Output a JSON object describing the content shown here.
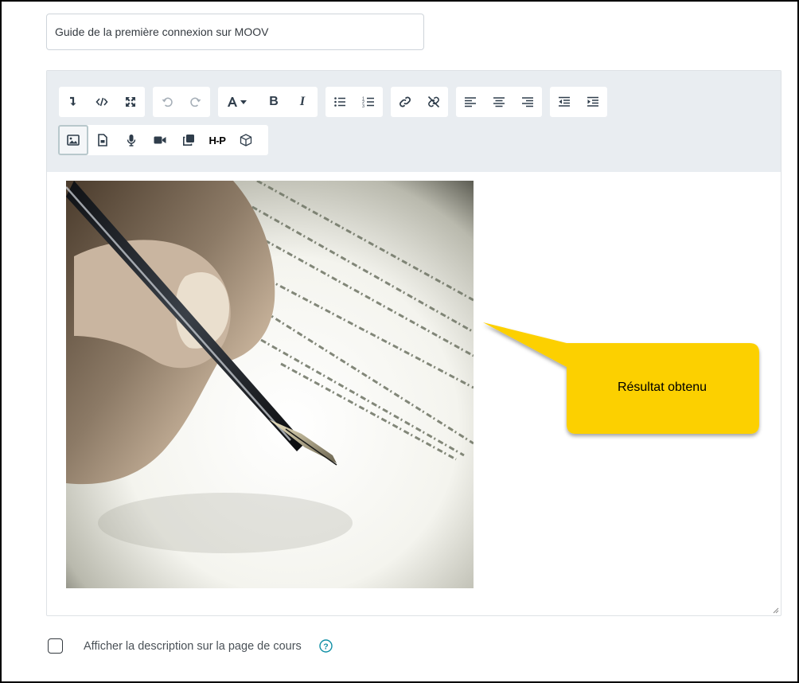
{
  "form": {
    "name_value": "Guide de la première connexion sur MOOV",
    "show_description_label": "Afficher la description sur la page de cours",
    "show_description_checked": false
  },
  "toolbar": {
    "row1": [
      {
        "name": "show-more-buttons-button",
        "icon": "arrow-down-right-icon",
        "state": "normal"
      },
      {
        "name": "html-source-button",
        "icon": "code-icon",
        "state": "normal"
      },
      {
        "name": "fullscreen-button",
        "icon": "expand-icon",
        "state": "normal"
      },
      {
        "name": "undo-button",
        "icon": "undo-icon",
        "state": "disabled"
      },
      {
        "name": "redo-button",
        "icon": "redo-icon",
        "state": "disabled"
      },
      {
        "name": "font-style-button",
        "icon": "font-icon",
        "state": "normal"
      },
      {
        "name": "bold-button",
        "icon": "bold-icon",
        "state": "normal"
      },
      {
        "name": "italic-button",
        "icon": "italic-icon",
        "state": "normal"
      },
      {
        "name": "bullet-list-button",
        "icon": "unordered-list-icon",
        "state": "normal"
      },
      {
        "name": "numbered-list-button",
        "icon": "ordered-list-icon",
        "state": "normal"
      },
      {
        "name": "link-button",
        "icon": "link-icon",
        "state": "normal"
      },
      {
        "name": "unlink-button",
        "icon": "unlink-icon",
        "state": "normal"
      },
      {
        "name": "align-left-button",
        "icon": "align-left-icon",
        "state": "normal"
      },
      {
        "name": "align-center-button",
        "icon": "align-center-icon",
        "state": "normal"
      },
      {
        "name": "align-right-button",
        "icon": "align-right-icon",
        "state": "normal"
      },
      {
        "name": "outdent-button",
        "icon": "outdent-icon",
        "state": "normal"
      },
      {
        "name": "indent-button",
        "icon": "indent-icon",
        "state": "normal"
      }
    ],
    "row2": [
      {
        "name": "insert-image-button",
        "icon": "image-icon",
        "state": "active"
      },
      {
        "name": "insert-media-button",
        "icon": "file-icon",
        "state": "normal"
      },
      {
        "name": "record-audio-button",
        "icon": "microphone-icon",
        "state": "normal"
      },
      {
        "name": "record-video-button",
        "icon": "video-camera-icon",
        "state": "normal"
      },
      {
        "name": "manage-files-button",
        "icon": "copy-files-icon",
        "state": "normal"
      },
      {
        "name": "insert-h5p-button",
        "icon": "h5p-icon",
        "label": "H-P",
        "state": "normal"
      },
      {
        "name": "content-bank-button",
        "icon": "cube-icon",
        "state": "normal"
      }
    ]
  },
  "annotation": {
    "callout_text": "Résultat obtenu",
    "callout_color": "#fcd000"
  },
  "colors": {
    "toolbar_bg": "#e9edf1",
    "help_icon": "#0f8fa5"
  }
}
